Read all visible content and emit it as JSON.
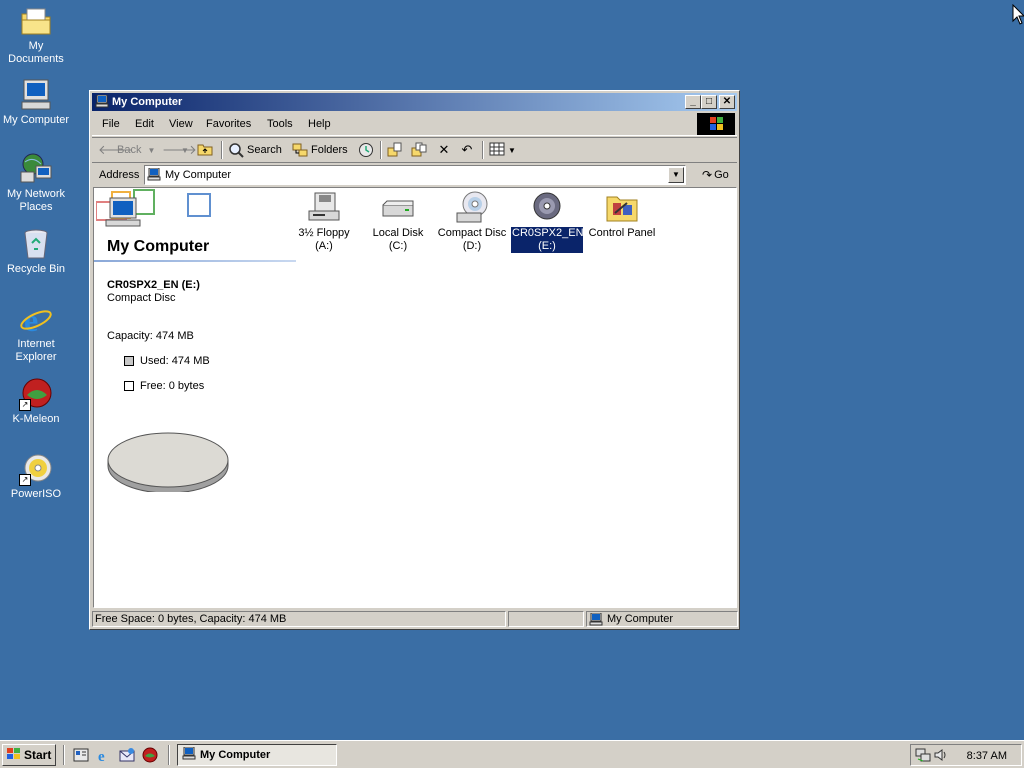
{
  "desktop": {
    "icons": [
      {
        "label": "My Documents",
        "icon": "folder-documents-icon"
      },
      {
        "label": "My Computer",
        "icon": "computer-icon"
      },
      {
        "label": "My Network Places",
        "icon": "network-icon"
      },
      {
        "label": "Recycle Bin",
        "icon": "recycle-bin-icon"
      },
      {
        "label": "Internet Explorer",
        "icon": "internet-explorer-icon"
      },
      {
        "label": "K-Meleon",
        "icon": "k-meleon-icon"
      },
      {
        "label": "PowerISO",
        "icon": "poweriso-icon"
      }
    ]
  },
  "window": {
    "title": "My Computer",
    "menu": [
      "File",
      "Edit",
      "View",
      "Favorites",
      "Tools",
      "Help"
    ],
    "toolbar": {
      "back": "Back",
      "search": "Search",
      "folders": "Folders"
    },
    "address": {
      "label": "Address",
      "value": "My Computer",
      "go": "Go"
    },
    "banner_title": "My Computer",
    "details": {
      "name": "CR0SPX2_EN (E:)",
      "type": "Compact Disc",
      "capacity": "Capacity: 474 MB",
      "used": "Used: 474 MB",
      "free": "Free: 0 bytes",
      "used_fraction": 1.0
    },
    "items": [
      {
        "label": "3½ Floppy (A:)",
        "icon": "floppy-drive-icon",
        "selected": false
      },
      {
        "label": "Local Disk (C:)",
        "icon": "hard-disk-icon",
        "selected": false
      },
      {
        "label": "Compact Disc (D:)",
        "icon": "cd-drive-icon",
        "selected": false
      },
      {
        "label": "CR0SPX2_EN (E:)",
        "icon": "cd-disc-icon",
        "selected": true
      },
      {
        "label": "Control Panel",
        "icon": "control-panel-icon",
        "selected": false
      }
    ],
    "status": {
      "left": "Free Space: 0 bytes, Capacity: 474 MB",
      "right": "My Computer"
    }
  },
  "taskbar": {
    "start": "Start",
    "task": "My Computer",
    "clock": "8:37 AM"
  },
  "colors": {
    "desktop": "#3A6EA5",
    "title_start": "#0A246A",
    "title_end": "#A6CAF0",
    "selection": "#0A246A",
    "face": "#D4D0C8"
  }
}
